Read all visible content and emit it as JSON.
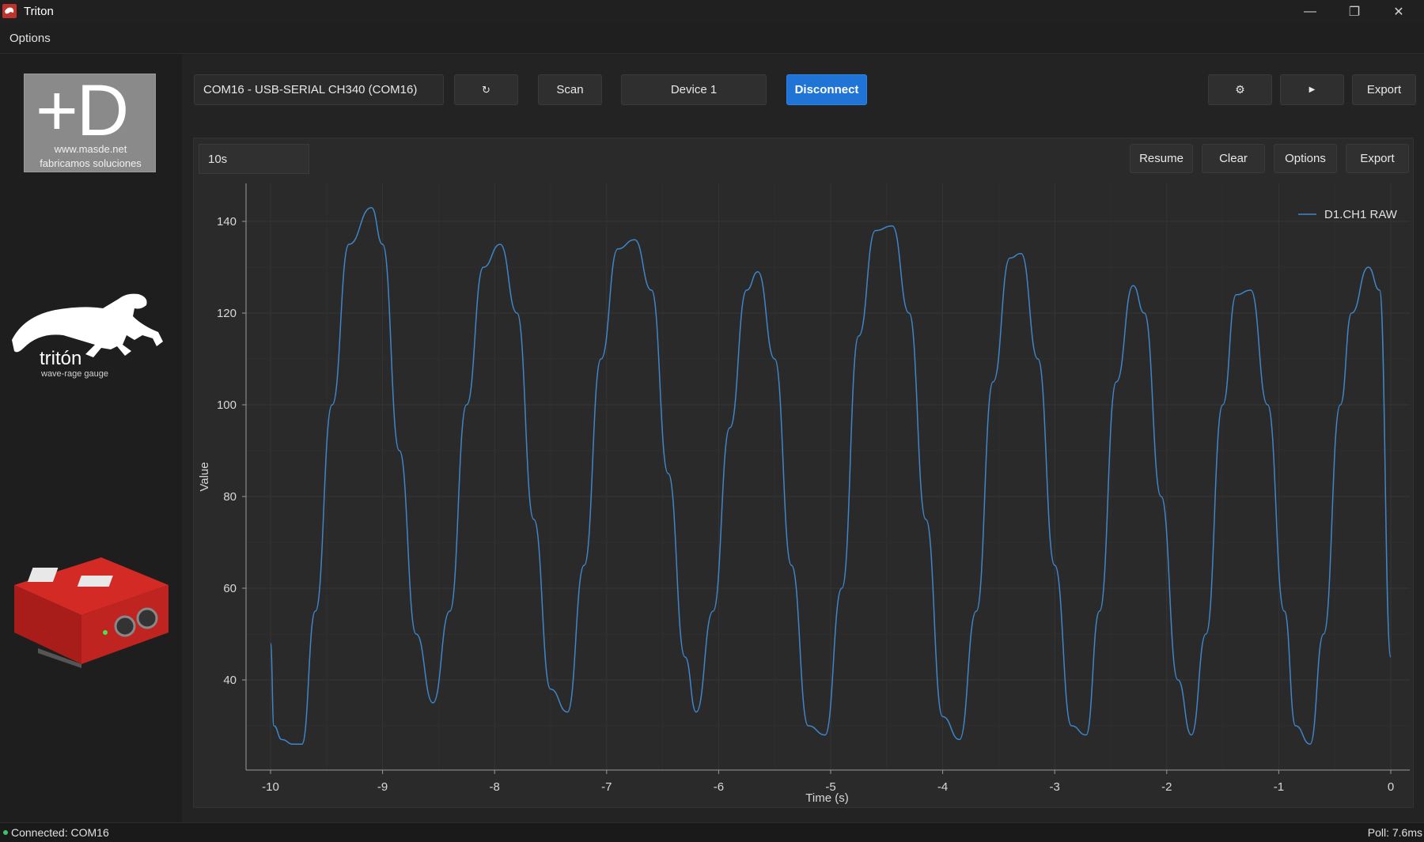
{
  "window": {
    "title": "Triton",
    "minimize_icon": "minimize-icon",
    "maximize_icon": "restore-icon",
    "close_icon": "close-icon"
  },
  "menu": {
    "options_label": "Options"
  },
  "sidebar": {
    "masde_logo_big": "+D",
    "masde_url": "www.masde.net",
    "masde_tagline": "fabricamos soluciones",
    "triton_name": "tritón",
    "triton_subtitle": "wave-rage gauge"
  },
  "toolbar": {
    "port_value": "COM16 - USB-SERIAL CH340 (COM16)",
    "refresh_icon": "refresh-icon",
    "refresh_glyph": "↻",
    "scan_label": "Scan",
    "device_label": "Device 1",
    "disconnect_label": "Disconnect",
    "settings_icon": "gear-icon",
    "settings_glyph": "⚙",
    "play_icon": "play-icon",
    "play_glyph": "▶",
    "export_label": "Export"
  },
  "plot_toolbar": {
    "range_value": "10s",
    "resume_label": "Resume",
    "clear_label": "Clear",
    "options_label": "Options",
    "export_label": "Export"
  },
  "status": {
    "left": "Connected: COM16",
    "right": "Poll: 7.6ms"
  },
  "colors": {
    "accent": "#1f74d6",
    "series": "#3f86c9",
    "status_ok": "#3cc46a"
  },
  "chart_data": {
    "type": "line",
    "title": "",
    "xlabel": "Time (s)",
    "ylabel": "Value",
    "xlim": [
      -10,
      0
    ],
    "ylim": [
      20,
      150
    ],
    "xticks": [
      "-10",
      "-9",
      "-8",
      "-7",
      "-6",
      "-5",
      "-4",
      "-3",
      "-2",
      "-1",
      "0"
    ],
    "yticks": [
      "40",
      "60",
      "80",
      "100",
      "120",
      "140"
    ],
    "grid": true,
    "legend": "top-right",
    "series": [
      {
        "name": "D1.CH1 RAW",
        "points": [
          [
            -10.0,
            48
          ],
          [
            -9.97,
            30
          ],
          [
            -9.9,
            27
          ],
          [
            -9.8,
            26
          ],
          [
            -9.72,
            26
          ],
          [
            -9.6,
            55
          ],
          [
            -9.45,
            100
          ],
          [
            -9.3,
            135
          ],
          [
            -9.1,
            143
          ],
          [
            -9.0,
            135
          ],
          [
            -8.85,
            90
          ],
          [
            -8.7,
            50
          ],
          [
            -8.55,
            35
          ],
          [
            -8.4,
            55
          ],
          [
            -8.25,
            100
          ],
          [
            -8.1,
            130
          ],
          [
            -7.95,
            135
          ],
          [
            -7.8,
            120
          ],
          [
            -7.65,
            75
          ],
          [
            -7.5,
            38
          ],
          [
            -7.35,
            33
          ],
          [
            -7.2,
            65
          ],
          [
            -7.05,
            110
          ],
          [
            -6.9,
            134
          ],
          [
            -6.75,
            136
          ],
          [
            -6.6,
            125
          ],
          [
            -6.45,
            85
          ],
          [
            -6.3,
            45
          ],
          [
            -6.2,
            33
          ],
          [
            -6.05,
            55
          ],
          [
            -5.9,
            95
          ],
          [
            -5.75,
            125
          ],
          [
            -5.65,
            129
          ],
          [
            -5.5,
            110
          ],
          [
            -5.35,
            65
          ],
          [
            -5.2,
            30
          ],
          [
            -5.05,
            28
          ],
          [
            -4.9,
            60
          ],
          [
            -4.75,
            115
          ],
          [
            -4.6,
            138
          ],
          [
            -4.45,
            139
          ],
          [
            -4.3,
            120
          ],
          [
            -4.15,
            75
          ],
          [
            -4.0,
            32
          ],
          [
            -3.85,
            27
          ],
          [
            -3.7,
            55
          ],
          [
            -3.55,
            105
          ],
          [
            -3.4,
            132
          ],
          [
            -3.3,
            133
          ],
          [
            -3.15,
            110
          ],
          [
            -3.0,
            65
          ],
          [
            -2.85,
            30
          ],
          [
            -2.72,
            28
          ],
          [
            -2.6,
            55
          ],
          [
            -2.45,
            105
          ],
          [
            -2.3,
            126
          ],
          [
            -2.2,
            120
          ],
          [
            -2.05,
            80
          ],
          [
            -1.9,
            40
          ],
          [
            -1.78,
            28
          ],
          [
            -1.65,
            50
          ],
          [
            -1.5,
            100
          ],
          [
            -1.38,
            124
          ],
          [
            -1.25,
            125
          ],
          [
            -1.1,
            100
          ],
          [
            -0.95,
            55
          ],
          [
            -0.85,
            30
          ],
          [
            -0.72,
            26
          ],
          [
            -0.6,
            50
          ],
          [
            -0.45,
            100
          ],
          [
            -0.35,
            120
          ],
          [
            -0.2,
            130
          ],
          [
            -0.1,
            125
          ],
          [
            0.0,
            45
          ]
        ]
      }
    ]
  }
}
